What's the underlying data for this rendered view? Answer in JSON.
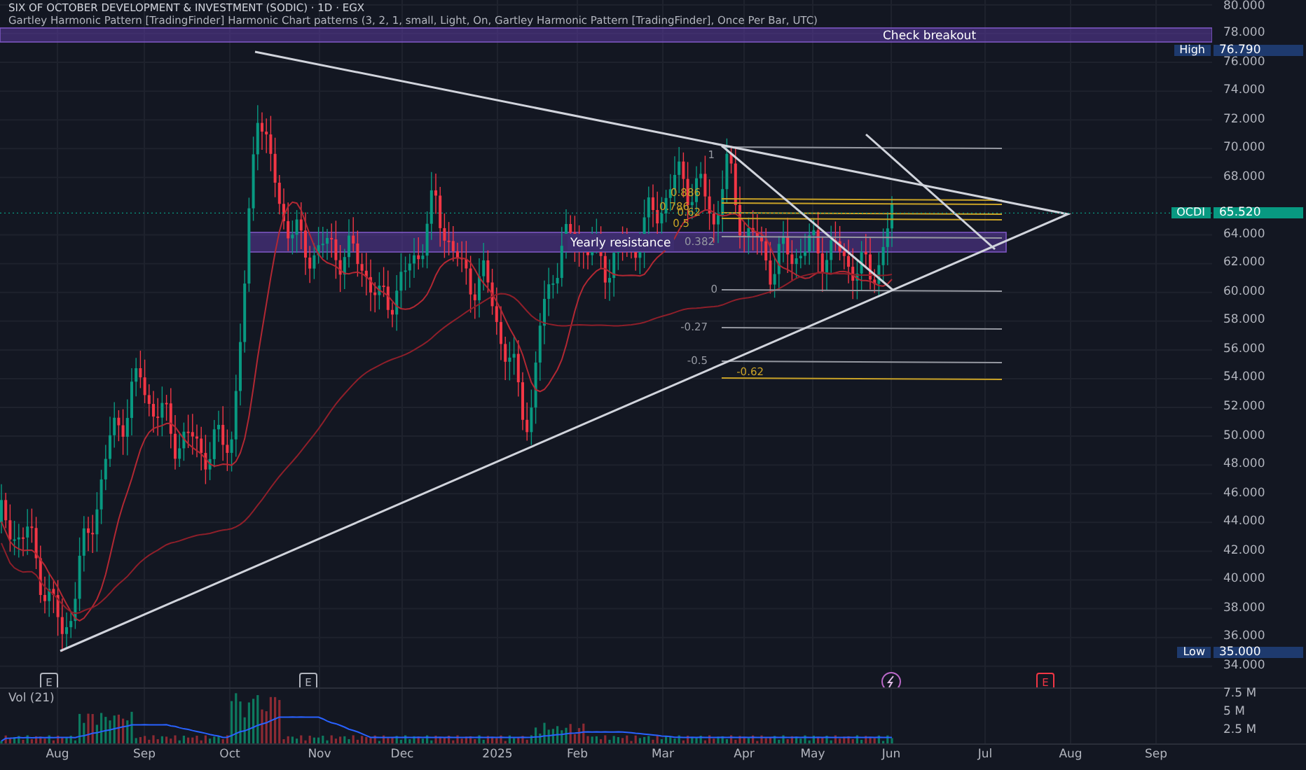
{
  "chart": {
    "title": "SIX OF OCTOBER DEVELOPMENT & INVESTMENT (SODIC) · 1D · EGX",
    "indicator": "Gartley Harmonic Pattern [TradingFinder] Harmonic Chart patterns (3, 2, 1, small, Light, On, Gartley Harmonic Pattern [TradingFinder], Once Per Bar, UTC)",
    "zones": [
      {
        "label": "Check breakout"
      },
      {
        "label": "Yearly resistance"
      }
    ],
    "fib_levels": [
      {
        "label": "1",
        "color": "#9598a1"
      },
      {
        "label": "0.886",
        "color": "#c9a227"
      },
      {
        "label": "0.786",
        "color": "#c9a227"
      },
      {
        "label": "0.62",
        "color": "#c9a227"
      },
      {
        "label": "0.5",
        "color": "#c9a227"
      },
      {
        "label": "0.382",
        "color": "#9598a1"
      },
      {
        "label": "0",
        "color": "#9598a1"
      },
      {
        "label": "-0.27",
        "color": "#9598a1"
      },
      {
        "label": "-0.5",
        "color": "#9598a1"
      },
      {
        "label": "-0.62",
        "color": "#c9a227"
      }
    ],
    "events": [
      {
        "kind": "earnings",
        "label": "E",
        "upcoming": false
      },
      {
        "kind": "earnings",
        "label": "E",
        "upcoming": false
      },
      {
        "kind": "split"
      },
      {
        "kind": "earnings",
        "label": "E",
        "upcoming": true
      }
    ]
  },
  "price_axis": {
    "ticks": [
      "80.000",
      "78.000",
      "76.000",
      "74.000",
      "72.000",
      "70.000",
      "68.000",
      "64.000",
      "62.000",
      "60.000",
      "58.000",
      "56.000",
      "54.000",
      "52.000",
      "50.000",
      "48.000",
      "46.000",
      "44.000",
      "42.000",
      "40.000",
      "38.000",
      "36.000",
      "34.000"
    ],
    "badges": [
      {
        "kind": "high",
        "label": "High",
        "value": "76.790"
      },
      {
        "kind": "last",
        "label": "OCDI",
        "value": "65.520"
      },
      {
        "kind": "low",
        "label": "Low",
        "value": "35.000"
      }
    ]
  },
  "volume": {
    "title": "Vol (21)",
    "ticks": [
      "7.5 M",
      "5 M",
      "2.5 M"
    ]
  },
  "time_axis": [
    "Aug",
    "Sep",
    "Oct",
    "Nov",
    "Dec",
    "2025",
    "Feb",
    "Mar",
    "Apr",
    "May",
    "Jun",
    "Jul",
    "Aug",
    "Sep"
  ]
}
